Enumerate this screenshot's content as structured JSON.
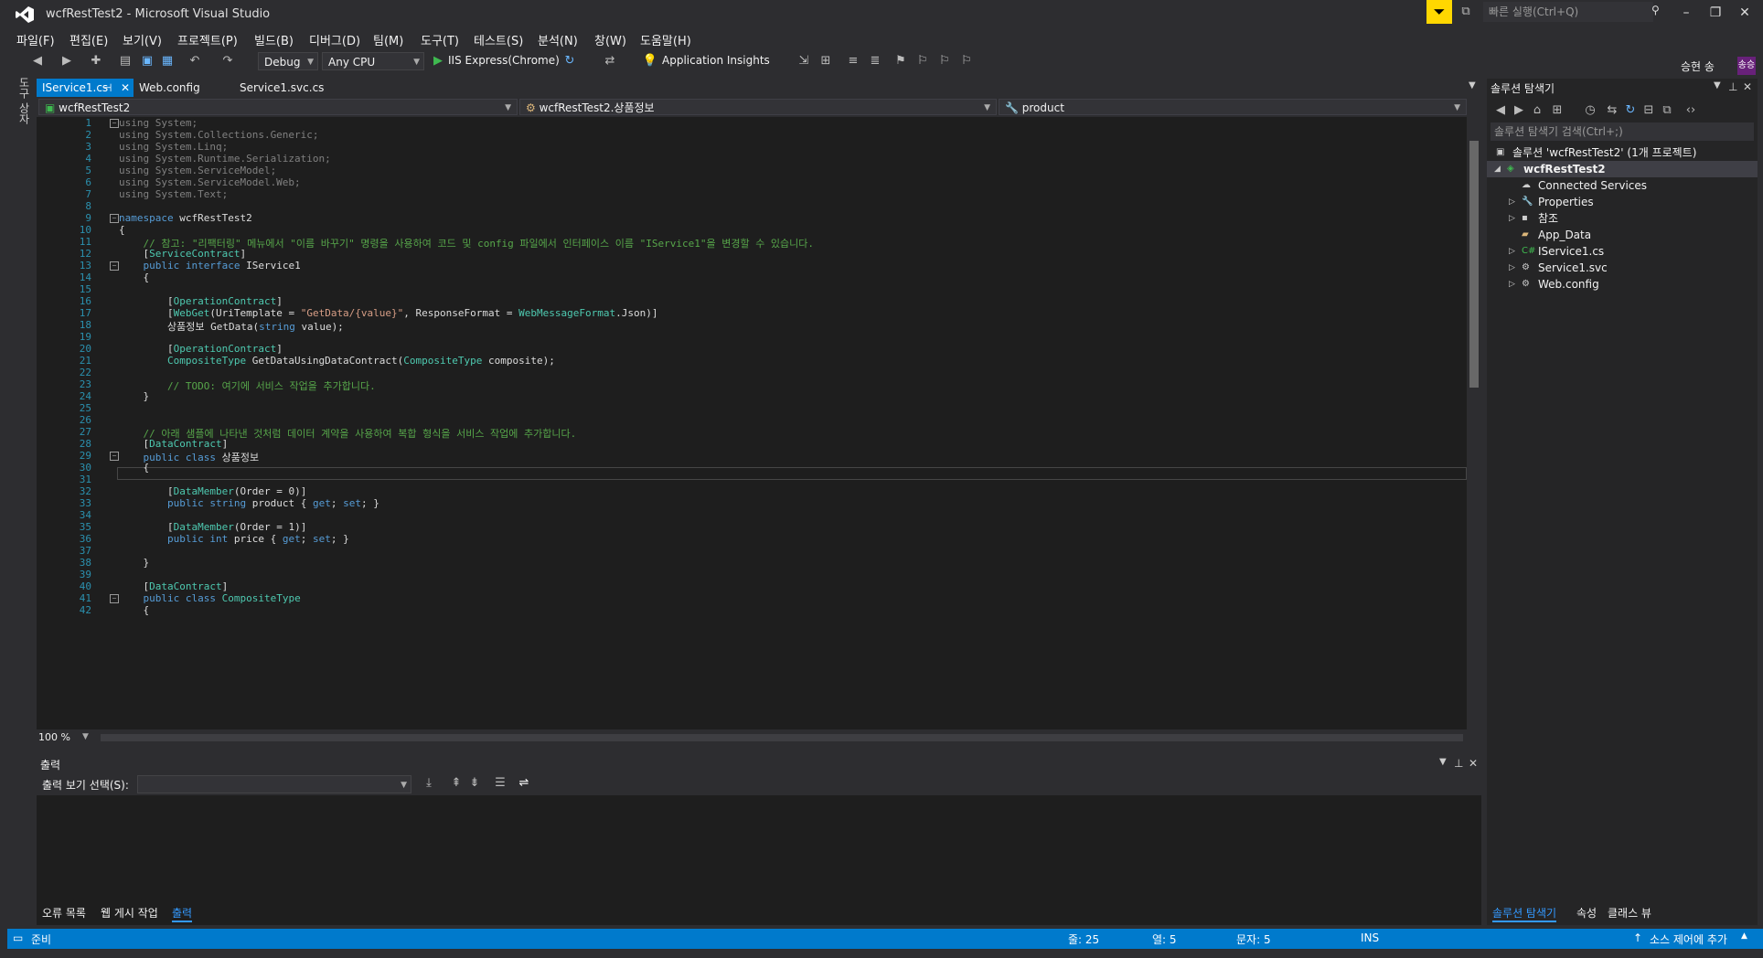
{
  "window": {
    "title": "wcfRestTest2 - Microsoft Visual Studio"
  },
  "quick_launch": {
    "placeholder": "빠른 실행(Ctrl+Q)"
  },
  "user": {
    "name": "승현 송",
    "avatar": "송승"
  },
  "menu": [
    "파일(F)",
    "편집(E)",
    "보기(V)",
    "프로젝트(P)",
    "빌드(B)",
    "디버그(D)",
    "팀(M)",
    "도구(T)",
    "테스트(S)",
    "분석(N)",
    "창(W)",
    "도움말(H)"
  ],
  "toolbar": {
    "config": "Debug",
    "platform": "Any CPU",
    "run_target": "IIS Express(Chrome)",
    "insights": "Application Insights"
  },
  "left_strip": {
    "label": "도구 상자"
  },
  "editor": {
    "tabs": [
      "IService1.cs",
      "Web.config",
      "Service1.svc.cs"
    ],
    "nav": {
      "project": "wcfRestTest2",
      "type": "wcfRestTest2.상품정보",
      "member": "product"
    },
    "zoom": "100 %",
    "lines": [
      "using System;",
      "using System.Collections.Generic;",
      "using System.Linq;",
      "using System.Runtime.Serialization;",
      "using System.ServiceModel;",
      "using System.ServiceModel.Web;",
      "using System.Text;",
      "",
      "namespace wcfRestTest2",
      "{",
      "    // 참고: \"리팩터링\" 메뉴에서 \"이름 바꾸기\" 명령을 사용하여 코드 및 config 파일에서 인터페이스 이름 \"IService1\"을 변경할 수 있습니다.",
      "    [ServiceContract]",
      "    public interface IService1",
      "    {",
      "",
      "        [OperationContract]",
      "        [WebGet(UriTemplate = \"GetData/{value}\", ResponseFormat = WebMessageFormat.Json)]",
      "        상품정보 GetData(string value);",
      "",
      "        [OperationContract]",
      "        CompositeType GetDataUsingDataContract(CompositeType composite);",
      "",
      "        // TODO: 여기에 서비스 작업을 추가합니다.",
      "    }",
      "",
      "",
      "    // 아래 샘플에 나타낸 것처럼 데이터 계약을 사용하여 복합 형식을 서비스 작업에 추가합니다.",
      "    [DataContract]",
      "    public class 상품정보",
      "    {",
      "",
      "        [DataMember(Order = 0)]",
      "        public string product { get; set; }",
      "",
      "        [DataMember(Order = 1)]",
      "        public int price { get; set; }",
      "",
      "    }",
      "",
      "    [DataContract]",
      "    public class CompositeType",
      "    {"
    ]
  },
  "output": {
    "title": "출력",
    "select_label": "출력 보기 선택(S):",
    "select_value": ""
  },
  "bottom_tabs": [
    "오류 목록",
    "웹 게시 작업",
    "출력"
  ],
  "solution_explorer": {
    "title": "솔루션 탐색기",
    "search_placeholder": "솔루션 탐색기 검색(Ctrl+;)",
    "items": [
      {
        "label": "솔루션 'wcfRestTest2' (1개 프로젝트)",
        "icon": "solution-icon"
      },
      {
        "label": "wcfRestTest2",
        "icon": "project-icon"
      },
      {
        "label": "Connected Services",
        "icon": "connected-services-icon"
      },
      {
        "label": "Properties",
        "icon": "wrench-icon"
      },
      {
        "label": "참조",
        "icon": "references-icon"
      },
      {
        "label": "App_Data",
        "icon": "folder-icon"
      },
      {
        "label": "IService1.cs",
        "icon": "csharp-file-icon"
      },
      {
        "label": "Service1.svc",
        "icon": "svc-file-icon"
      },
      {
        "label": "Web.config",
        "icon": "config-file-icon"
      }
    ],
    "tabs": [
      "솔루션 탐색기",
      "속성",
      "클래스 뷰"
    ]
  },
  "status": {
    "ready": "준비",
    "line": "줄: 25",
    "col": "열: 5",
    "ch": "문자: 5",
    "mode": "INS",
    "source_control": "소스 제어에 추가"
  },
  "colors": {
    "accent": "#007acc",
    "background": "#2d2d30",
    "editor": "#1e1e1e"
  }
}
